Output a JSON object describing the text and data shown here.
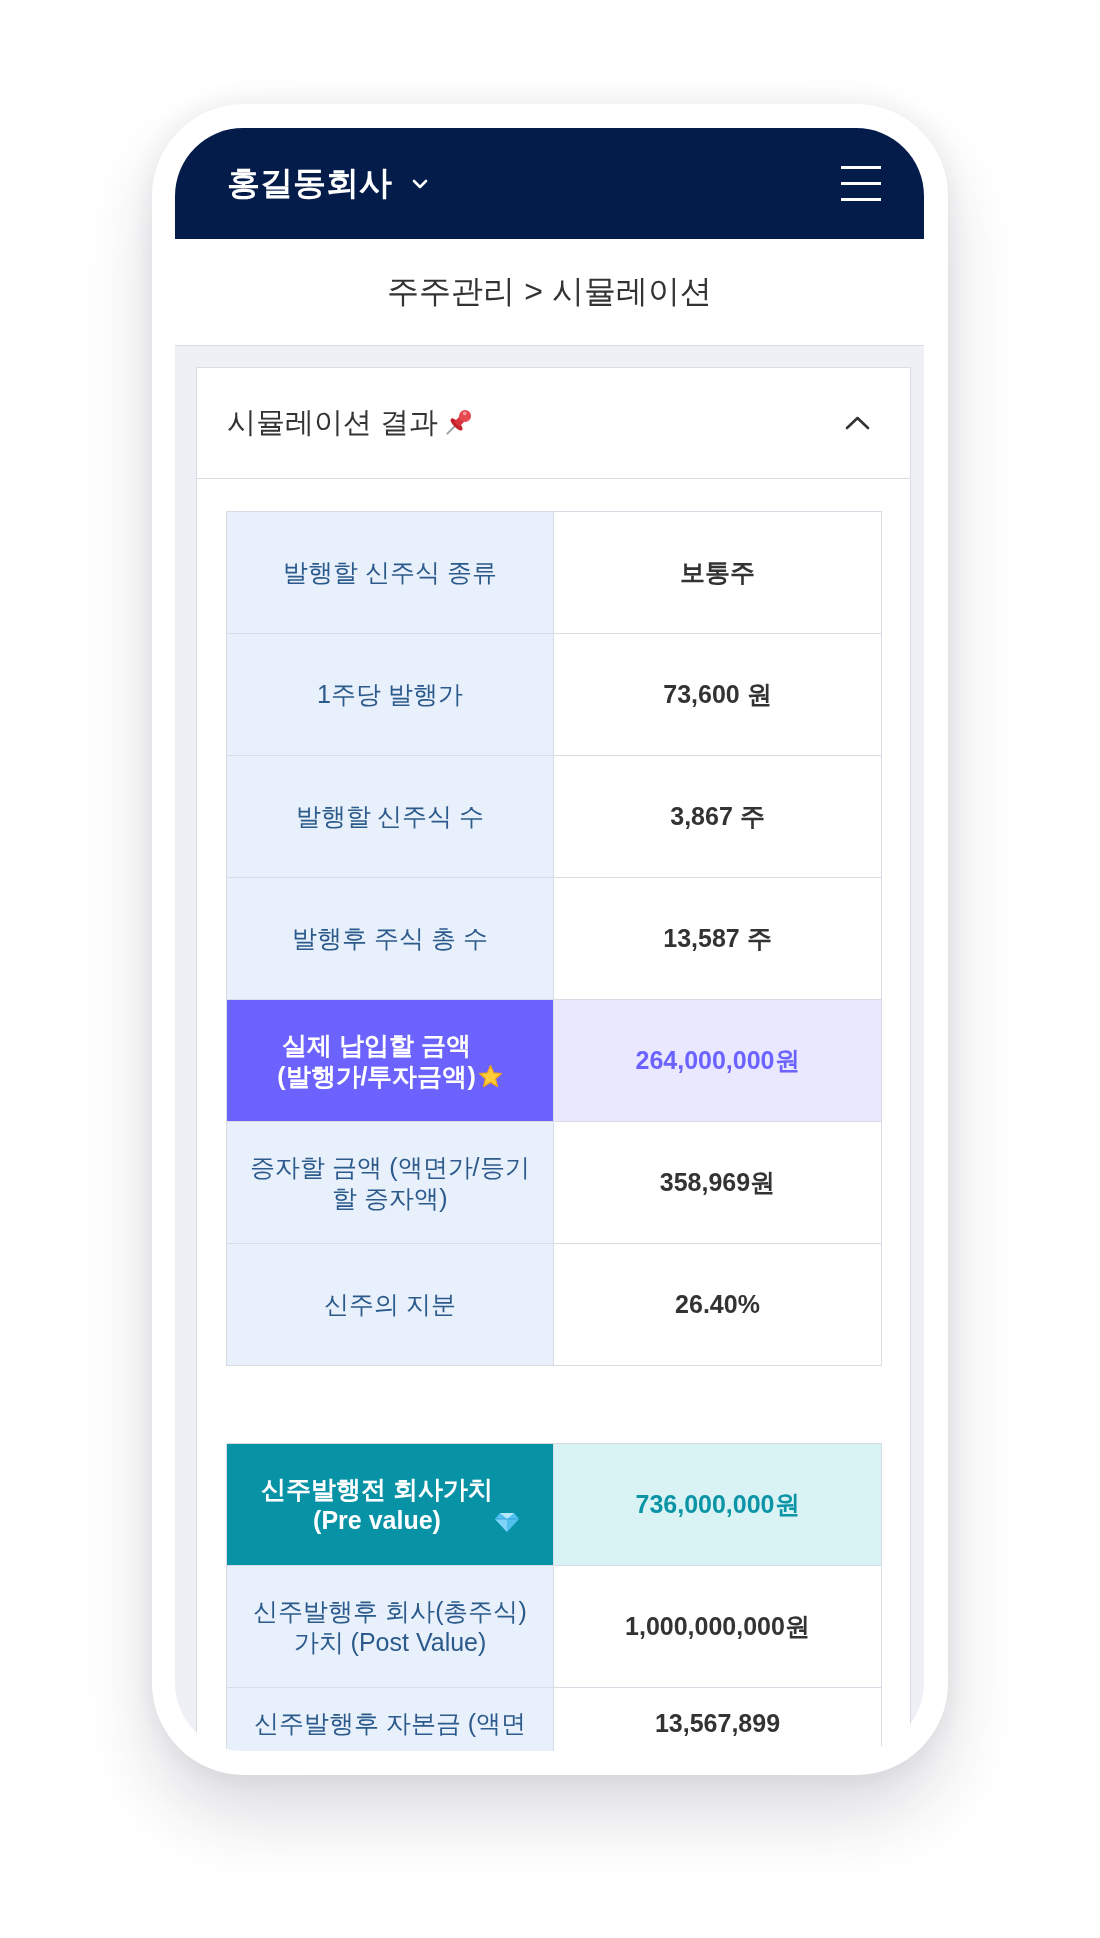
{
  "header": {
    "company": "홍길동회사"
  },
  "breadcrumb": "주주관리 > 시뮬레이션",
  "card": {
    "title": "시뮬레이션 결과",
    "expanded": true,
    "tables": [
      {
        "rows": [
          {
            "kind": "plain",
            "label": "발행할 신주식 종류",
            "value": "보통주"
          },
          {
            "kind": "plain",
            "label": "1주당 발행가",
            "value": "73,600 원"
          },
          {
            "kind": "plain",
            "label": "발행할 신주식 수",
            "value": "3,867 주"
          },
          {
            "kind": "plain",
            "label": "발행후 주식 총 수",
            "value": "13,587 주"
          },
          {
            "kind": "primary",
            "label": "실제 납입할 금액\n(발행가/투자금액)",
            "value": "264,000,000원"
          },
          {
            "kind": "plain",
            "label": "증자할 금액 (액면가/등기할 증자액)",
            "value": "358,969원"
          },
          {
            "kind": "plain",
            "label": "신주의 지분",
            "value": "26.40%"
          }
        ]
      },
      {
        "rows": [
          {
            "kind": "premium",
            "label": "신주발행전 회사가치\n(Pre value)",
            "value": "736,000,000원"
          },
          {
            "kind": "plain",
            "label": "신주발행후 회사(총주식) 가치 (Post Value)",
            "value": "1,000,000,000원"
          },
          {
            "kind": "plain",
            "label": "신주발행후 자본금 (액면",
            "value": "13,567,899"
          }
        ]
      }
    ]
  }
}
